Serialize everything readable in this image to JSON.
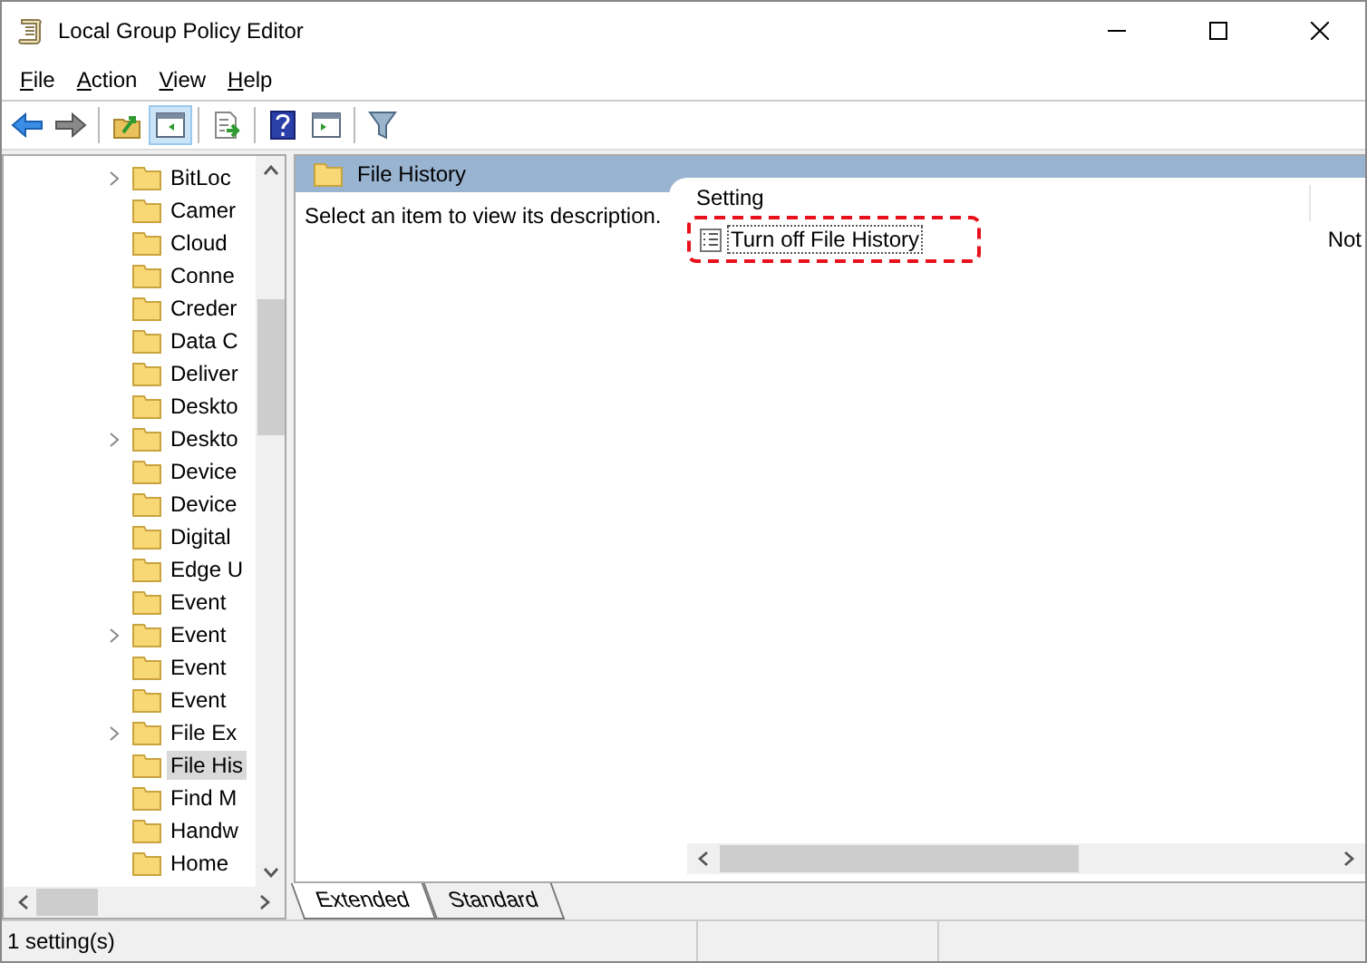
{
  "window": {
    "title": "Local Group Policy Editor"
  },
  "menu": [
    {
      "label": "File"
    },
    {
      "label": "Action"
    },
    {
      "label": "View"
    },
    {
      "label": "Help"
    }
  ],
  "toolbar": [
    {
      "kind": "back",
      "pressed": false
    },
    {
      "kind": "forward",
      "pressed": false
    },
    {
      "kind": "sep"
    },
    {
      "kind": "up",
      "pressed": false
    },
    {
      "kind": "tree",
      "pressed": true
    },
    {
      "kind": "sep"
    },
    {
      "kind": "export",
      "pressed": false
    },
    {
      "kind": "sep"
    },
    {
      "kind": "help",
      "pressed": false
    },
    {
      "kind": "pane",
      "pressed": false
    },
    {
      "kind": "sep"
    },
    {
      "kind": "filter",
      "pressed": false
    }
  ],
  "tree": [
    {
      "label": "BitLoc",
      "expandable": true,
      "selected": false
    },
    {
      "label": "Camer",
      "expandable": false,
      "selected": false
    },
    {
      "label": "Cloud",
      "expandable": false,
      "selected": false
    },
    {
      "label": "Conne",
      "expandable": false,
      "selected": false
    },
    {
      "label": "Creder",
      "expandable": false,
      "selected": false
    },
    {
      "label": "Data C",
      "expandable": false,
      "selected": false
    },
    {
      "label": "Deliver",
      "expandable": false,
      "selected": false
    },
    {
      "label": "Deskto",
      "expandable": false,
      "selected": false
    },
    {
      "label": "Deskto",
      "expandable": true,
      "selected": false
    },
    {
      "label": "Device",
      "expandable": false,
      "selected": false
    },
    {
      "label": "Device",
      "expandable": false,
      "selected": false
    },
    {
      "label": "Digital",
      "expandable": false,
      "selected": false
    },
    {
      "label": "Edge U",
      "expandable": false,
      "selected": false
    },
    {
      "label": "Event",
      "expandable": false,
      "selected": false
    },
    {
      "label": "Event",
      "expandable": true,
      "selected": false
    },
    {
      "label": "Event",
      "expandable": false,
      "selected": false
    },
    {
      "label": "Event",
      "expandable": false,
      "selected": false
    },
    {
      "label": "File Ex",
      "expandable": true,
      "selected": false
    },
    {
      "label": "File His",
      "expandable": false,
      "selected": true
    },
    {
      "label": "Find M",
      "expandable": false,
      "selected": false
    },
    {
      "label": "Handw",
      "expandable": false,
      "selected": false
    },
    {
      "label": "Home",
      "expandable": false,
      "selected": false
    }
  ],
  "details": {
    "header": "File History",
    "description": "Select an item to view its description.",
    "columns": [
      "Setting"
    ],
    "rows": [
      {
        "setting": "Turn off File History",
        "state": "Not",
        "highlighted": true
      }
    ]
  },
  "view_tabs": [
    {
      "label": "Extended",
      "selected": true
    },
    {
      "label": "Standard",
      "selected": false
    }
  ],
  "status_bar": "1 setting(s)"
}
